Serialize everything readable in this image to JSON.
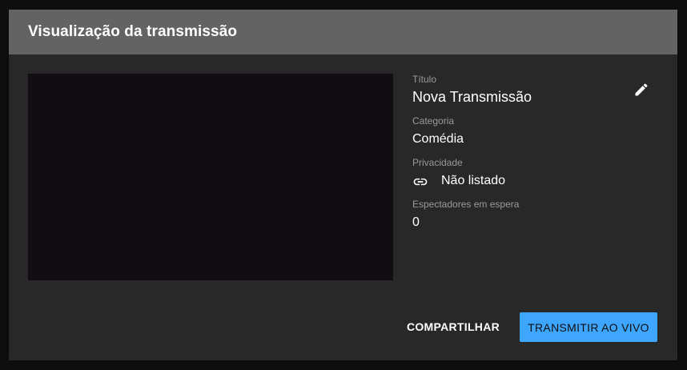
{
  "dialog": {
    "title": "Visualização da transmissão"
  },
  "details": {
    "title_label": "Título",
    "title_value": "Nova Transmissão",
    "category_label": "Categoria",
    "category_value": "Comédia",
    "privacy_label": "Privacidade",
    "privacy_value": "Não listado",
    "privacy_icon": "link-icon",
    "waiting_label": "Espectadores em espera",
    "waiting_value": "0",
    "edit_icon": "pencil-icon"
  },
  "actions": {
    "share_label": "COMPARTILHAR",
    "go_live_label": "TRANSMITIR AO VIVO"
  },
  "colors": {
    "header_bg": "#636363",
    "dialog_bg": "#282828",
    "primary_button": "#3ea6ff"
  }
}
